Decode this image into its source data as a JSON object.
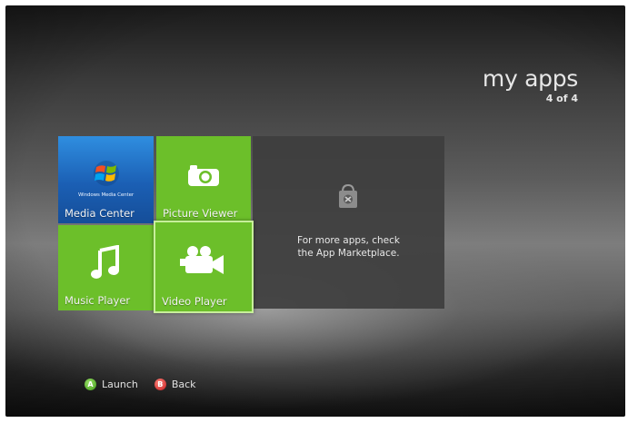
{
  "header": {
    "title": "my apps",
    "count": "4 of 4"
  },
  "tiles": [
    {
      "label": "Media Center",
      "logo_text": "Windows Media Center"
    },
    {
      "label": "Picture Viewer"
    },
    {
      "label": "Music Player"
    },
    {
      "label": "Video Player"
    }
  ],
  "marketplace": {
    "line1": "For more apps, check",
    "line2": "the App Marketplace."
  },
  "footer": {
    "launch": {
      "button": "A",
      "label": "Launch"
    },
    "back": {
      "button": "B",
      "label": "Back"
    }
  },
  "colors": {
    "tile_green": "#6cbf2a",
    "tile_blue": "#1b5fb4",
    "focus_border": "#c8ef9b"
  },
  "icons": [
    "windows-logo-icon",
    "camera-icon",
    "music-note-icon",
    "video-camera-icon",
    "shopping-bag-icon"
  ]
}
